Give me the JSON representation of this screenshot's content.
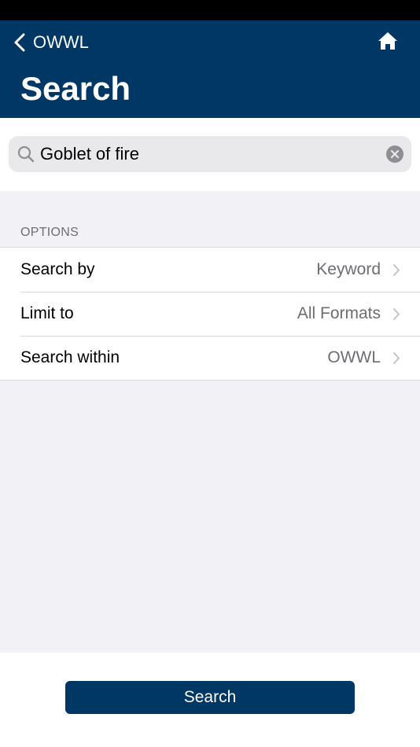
{
  "header": {
    "back_label": "OWWL",
    "title": "Search"
  },
  "search": {
    "value": "Goblet of fire"
  },
  "options": {
    "section_title": "OPTIONS",
    "rows": [
      {
        "label": "Search by",
        "value": "Keyword"
      },
      {
        "label": "Limit to",
        "value": "All Formats"
      },
      {
        "label": "Search within",
        "value": "OWWL"
      }
    ]
  },
  "footer": {
    "search_button_label": "Search"
  },
  "colors": {
    "brand": "#003764",
    "grouped_background": "#f1f1f6",
    "search_field": "#e9e9eb",
    "secondary_text": "#6d6d72"
  },
  "icons": {
    "back": "chevron-left-icon",
    "home": "home-icon",
    "search": "search-icon",
    "clear": "clear-icon",
    "row_disclosure": "chevron-right-icon"
  }
}
